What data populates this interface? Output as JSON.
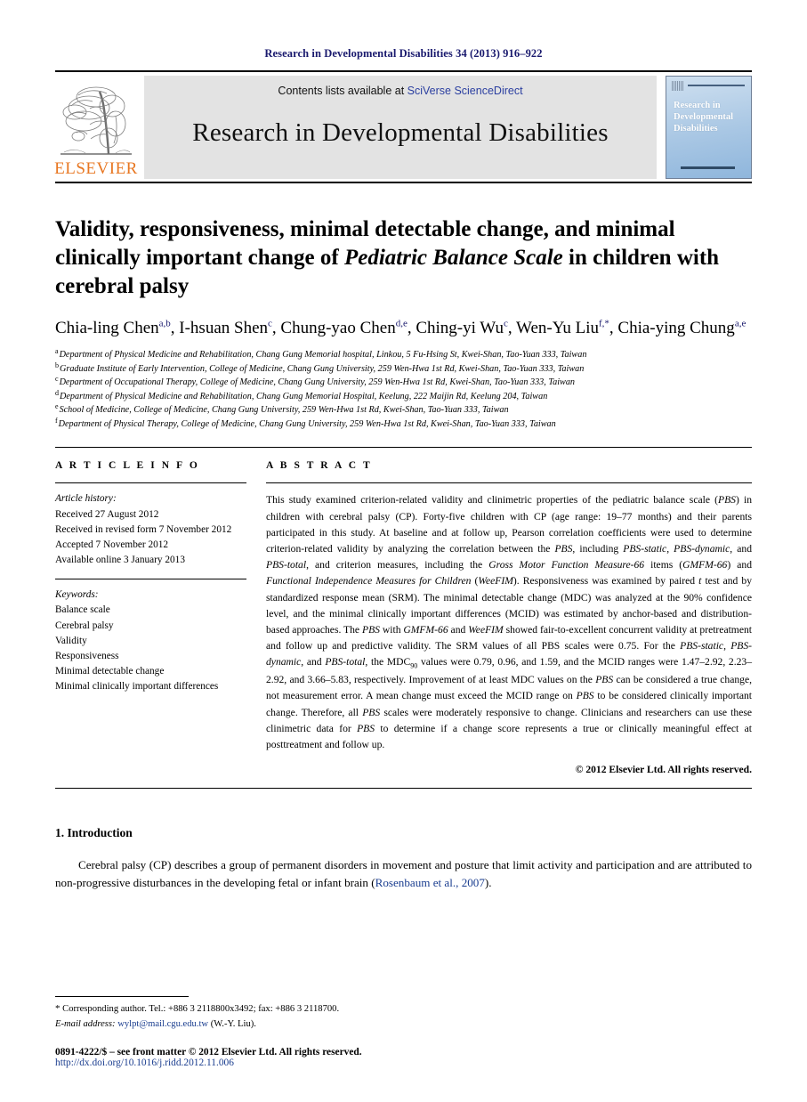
{
  "running_head": "Research in Developmental Disabilities 34 (2013) 916–922",
  "masthead": {
    "publisher_logo_text": "ELSEVIER",
    "contents_prefix": "Contents lists available at ",
    "contents_link": "SciVerse ScienceDirect",
    "journal_name": "Research in Developmental Disabilities",
    "cover_title": "Research in Developmental Disabilities"
  },
  "article": {
    "title_part1": "Validity, responsiveness, minimal detectable change, and minimal clinically important change of ",
    "title_italic": "Pediatric Balance Scale",
    "title_part2": " in children with cerebral palsy",
    "authors": [
      {
        "name": "Chia-ling Chen",
        "marks": "a,b",
        "sep": ", "
      },
      {
        "name": "I-hsuan Shen",
        "marks": "c",
        "sep": ", "
      },
      {
        "name": "Chung-yao Chen",
        "marks": "d,e",
        "sep": ", "
      },
      {
        "name": "Ching-yi Wu",
        "marks": "c",
        "sep": ", "
      },
      {
        "name": "Wen-Yu Liu",
        "marks": "f,*",
        "sep": ", "
      },
      {
        "name": "Chia-ying Chung",
        "marks": "a,e",
        "sep": ""
      }
    ],
    "affiliations": [
      {
        "mark": "a",
        "text": "Department of Physical Medicine and Rehabilitation, Chang Gung Memorial hospital, Linkou, 5 Fu-Hsing St, Kwei-Shan, Tao-Yuan 333, Taiwan"
      },
      {
        "mark": "b",
        "text": "Graduate Institute of Early Intervention, College of Medicine, Chang Gung University, 259 Wen-Hwa 1st Rd, Kwei-Shan, Tao-Yuan 333, Taiwan"
      },
      {
        "mark": "c",
        "text": "Department of Occupational Therapy, College of Medicine, Chang Gung University, 259 Wen-Hwa 1st Rd, Kwei-Shan, Tao-Yuan 333, Taiwan"
      },
      {
        "mark": "d",
        "text": "Department of Physical Medicine and Rehabilitation, Chang Gung Memorial Hospital, Keelung, 222 Maijin Rd, Keelung 204, Taiwan"
      },
      {
        "mark": "e",
        "text": "School of Medicine, College of Medicine, Chang Gung University, 259 Wen-Hwa 1st Rd, Kwei-Shan, Tao-Yuan 333, Taiwan"
      },
      {
        "mark": "f",
        "text": "Department of Physical Therapy, College of Medicine, Chang Gung University, 259 Wen-Hwa 1st Rd, Kwei-Shan, Tao-Yuan 333, Taiwan"
      }
    ]
  },
  "article_info": {
    "heading": "A R T I C L E   I N F O",
    "history_label": "Article history:",
    "history": [
      "Received 27 August 2012",
      "Received in revised form 7 November 2012",
      "Accepted 7 November 2012",
      "Available online 3 January 2013"
    ],
    "keywords_label": "Keywords:",
    "keywords": [
      "Balance scale",
      "Cerebral palsy",
      "Validity",
      "Responsiveness",
      "Minimal detectable change",
      "Minimal clinically important differences"
    ]
  },
  "abstract": {
    "heading": "A B S T R A C T",
    "copyright": "© 2012 Elsevier Ltd. All rights reserved."
  },
  "introduction": {
    "heading": "1. Introduction",
    "paragraph_a": "Cerebral palsy (CP) describes a group of permanent disorders in movement and posture that limit activity and participation and are attributed to non-progressive disturbances in the developing fetal or infant brain (",
    "citation": "Rosenbaum et al., 2007",
    "paragraph_b": ")."
  },
  "footer": {
    "corresponding_star": "*",
    "corresponding": "Corresponding author. Tel.: +886 3 2118800x3492; fax: +886 3 2118700.",
    "email_label": "E-mail address:",
    "email": "wylpt@mail.cgu.edu.tw",
    "email_owner": "(W.-Y. Liu).",
    "issn": "0891-4222/$ – see front matter © 2012 Elsevier Ltd. All rights reserved.",
    "doi": "http://dx.doi.org/10.1016/j.ridd.2012.11.006"
  },
  "colors": {
    "running_head": "#1a1a6e",
    "elsevier_orange": "#E87722",
    "link_blue": "#2b3fa0",
    "citation_blue": "#1a3d8f",
    "band_gray": "#e3e3e3"
  }
}
